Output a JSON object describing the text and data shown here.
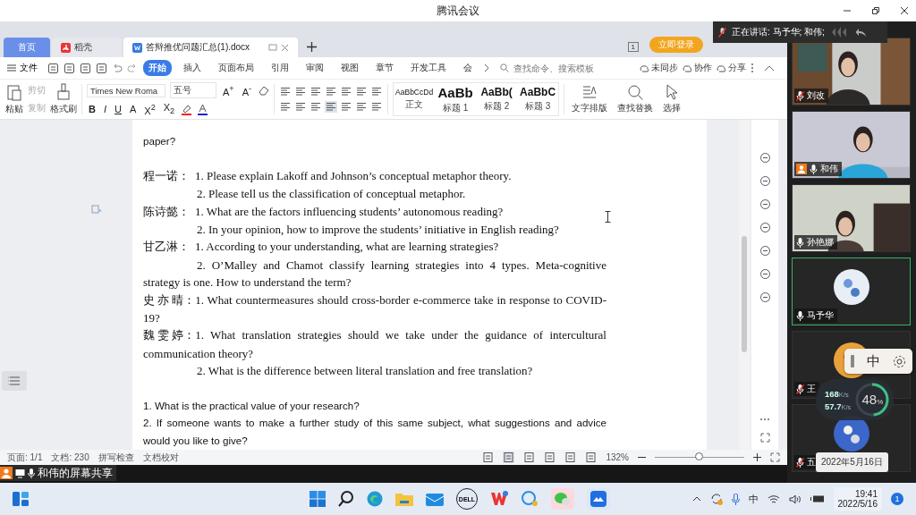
{
  "app_title": "腾讯会议",
  "speaking": "正在讲话: 马予华; 和伟;",
  "wps": {
    "tabs": [
      {
        "label": "首页",
        "kind": "home",
        "selected": false
      },
      {
        "label": "稻壳",
        "kind": "docer",
        "selected": false
      },
      {
        "label": "答辩推优问题汇总(1).docx",
        "kind": "doc",
        "selected": true
      }
    ],
    "window_count": "1",
    "login": "立即登录",
    "file_menu": "文件",
    "menus": [
      {
        "label": "开始",
        "selected": true
      },
      {
        "label": "插入",
        "selected": false
      },
      {
        "label": "页面布局",
        "selected": false
      },
      {
        "label": "引用",
        "selected": false
      },
      {
        "label": "审阅",
        "selected": false
      },
      {
        "label": "视图",
        "selected": false
      },
      {
        "label": "章节",
        "selected": false
      },
      {
        "label": "开发工具",
        "selected": false
      },
      {
        "label": "会",
        "selected": false
      }
    ],
    "search_placeholder": "查找命令、搜索模板",
    "actions": [
      "未同步",
      "协作",
      "分享"
    ],
    "paste": "粘贴",
    "cut": "剪切",
    "copy": "复制",
    "format_painter": "格式刷",
    "font": "Times New Roma",
    "font_size": "五号",
    "size_buttons": [
      "A$^{+}$",
      "A$^{-}$"
    ],
    "format_buttons": [
      "B",
      "I",
      "U",
      "A",
      "X$^{2}$",
      "X$_{2}$"
    ],
    "styles": [
      {
        "sample": "AaBbCcDd",
        "label": "正文"
      },
      {
        "sample": "AaBb",
        "label": "标题 1"
      },
      {
        "sample": "AaBb(",
        "label": "标题 2"
      },
      {
        "sample": "AaBbC",
        "label": "标题 3"
      }
    ],
    "tools": [
      {
        "label": "文字排版",
        "kind": "layout"
      },
      {
        "label": "查找替换",
        "kind": "find"
      },
      {
        "label": "选择",
        "kind": "select"
      }
    ],
    "document": [
      {
        "kind": "sans",
        "text": "paper?"
      },
      {
        "kind": "speaker",
        "speaker": "程一诺：",
        "text": "1. Please explain Lakoff and Johnson’s    conceptual metaphor theory.",
        "gap_before": true
      },
      {
        "kind": "indent",
        "text": "2. Please tell us the classification of conceptual metaphor."
      },
      {
        "kind": "speaker",
        "speaker": "陈诗懿：",
        "text": "1. What are the factors influencing students’ autonomous reading?"
      },
      {
        "kind": "indent",
        "text": "2. In your opinion, how to improve the students’ initiative in English reading?"
      },
      {
        "kind": "speaker",
        "speaker": "甘乙淋：",
        "text": "1. According to your understanding, what are learning strategies?"
      },
      {
        "kind": "indent",
        "text": "2. O’Malley and Chamot classify learning strategies into 4 types. Meta-cognitive strategy is one. How to understand the term?"
      },
      {
        "kind": "speaker",
        "speaker": "史 亦 晴：",
        "text": "1. What countermeasures should cross-border e-commerce take in response to COVID-19?"
      },
      {
        "kind": "speaker",
        "speaker": "魏 雯 婷：",
        "text": "1. What translation strategies should we take under the guidance of intercultural communication theory?"
      },
      {
        "kind": "indent",
        "text": "2.  What is the difference between literal translation and free translation?"
      },
      {
        "kind": "sans",
        "text": "1. What is the practical value of your research?",
        "gap_before": true
      },
      {
        "kind": "sans",
        "text": "2. If someone wants to make a further study of this same subject, what suggestions and advice would you like to give?"
      }
    ],
    "status": {
      "page": "页面: 1/1",
      "words": "文档: 230",
      "spell": "拼写检查",
      "proof": "文档校对",
      "zoom": "132%",
      "level": 0.5
    }
  },
  "share_label": "和伟的屏幕共享",
  "tiles": [
    {
      "name": "刘改",
      "kind": "video",
      "muted": true,
      "presenter": false,
      "active": false
    },
    {
      "name": "和伟",
      "kind": "video",
      "muted": false,
      "presenter": true,
      "active": false
    },
    {
      "name": "孙艳娜",
      "kind": "video",
      "muted": false,
      "presenter": false,
      "active": false
    },
    {
      "name": "马予华",
      "kind": "avatar",
      "muted": false,
      "presenter": false,
      "active": true
    },
    {
      "name": "王",
      "kind": "avatar",
      "muted": true,
      "presenter": false,
      "active": false
    },
    {
      "name": "五",
      "kind": "avatar",
      "muted": true,
      "presenter": false,
      "active": false
    }
  ],
  "ime": "中",
  "network": {
    "up": "168",
    "up_unit": "K/s",
    "down": "57.7",
    "down_unit": "K/s",
    "percent": "48",
    "percent_unit": "%",
    "level": 0.48
  },
  "date_tooltip": "2022年5月16日",
  "taskbar": {
    "dell": "DELL",
    "ime": "中",
    "time": "19:41",
    "date": "2022/5/16",
    "badge": "1"
  }
}
